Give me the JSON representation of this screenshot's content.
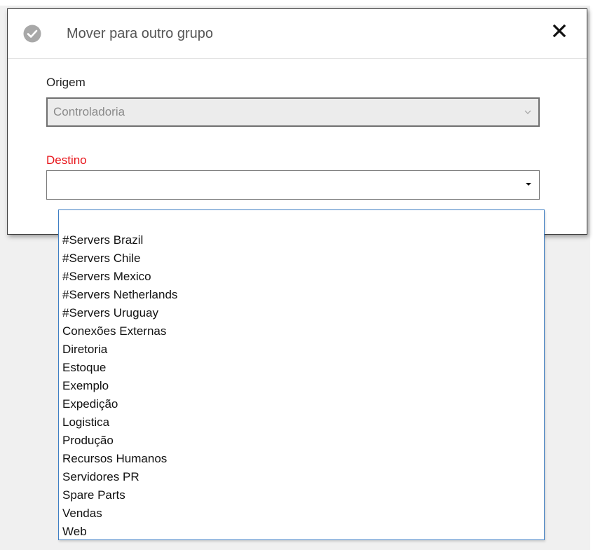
{
  "dialog": {
    "title": "Mover para outro grupo",
    "title_icon": "check-circle-icon",
    "close_icon": "close-icon"
  },
  "form": {
    "origem": {
      "label": "Origem",
      "value": "Controladoria",
      "enabled": false
    },
    "destino": {
      "label": "Destino",
      "value": "",
      "required": true,
      "open": true
    }
  },
  "destino_options": [
    "#Servers Brazil",
    "#Servers Chile",
    "#Servers Mexico",
    "#Servers Netherlands",
    "#Servers Uruguay",
    "Conexões Externas",
    "Diretoria",
    "Estoque",
    "Exemplo",
    "Expedição",
    "Logistica",
    "Produção",
    "Recursos Humanos",
    "Servidores PR",
    "Spare Parts",
    "Vendas",
    "Web"
  ],
  "colors": {
    "required_label": "#e8141a",
    "list_border": "#3f7fc4",
    "disabled_bg": "#ececec"
  }
}
